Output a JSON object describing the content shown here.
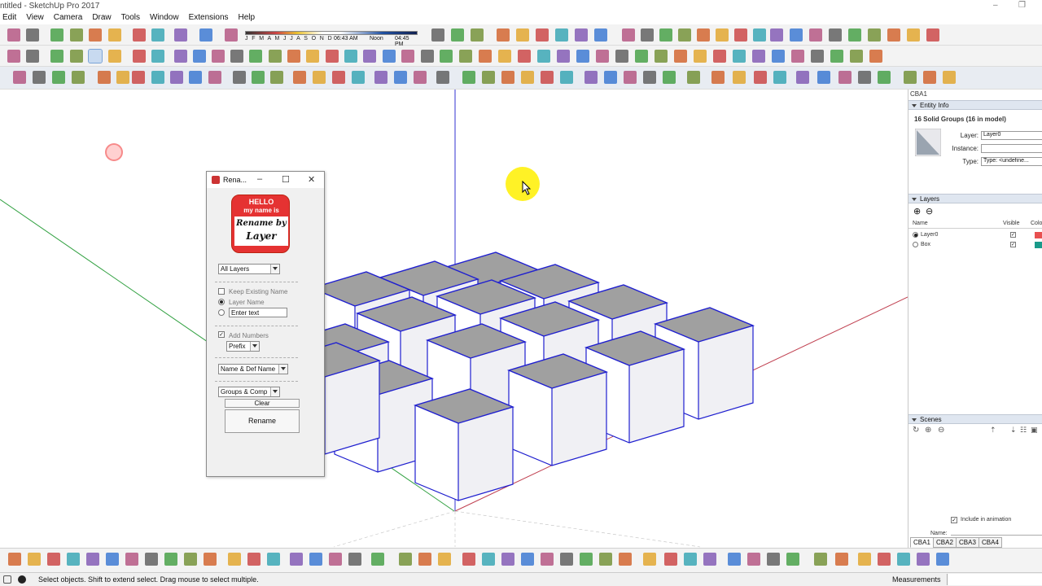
{
  "window": {
    "title": "ntitled - SketchUp Pro 2017",
    "controls": {
      "minimize": "–",
      "maximize": "❐"
    }
  },
  "menubar": {
    "items": [
      "Edit",
      "View",
      "Camera",
      "Draw",
      "Tools",
      "Window",
      "Extensions",
      "Help"
    ]
  },
  "time_slider": {
    "months": "J F M A M J J A S O N D",
    "sunrise": "06:43 AM",
    "noon": "Noon",
    "sunset": "04:45 PM"
  },
  "dialog": {
    "title": "Rena...",
    "controls": {
      "minimize": "–",
      "maximize": "☐",
      "close": "✕"
    },
    "logo": {
      "hello": "HELLO",
      "my_name_is": "my name is",
      "line1": "Rename by",
      "line2": "Layer"
    },
    "layer_filter": "All Layers",
    "keep_existing_name": {
      "label": "Keep Existing Name",
      "checked": false
    },
    "layer_name": {
      "label": "Layer Name",
      "selected": true
    },
    "enter_text": {
      "placeholder": "Enter text"
    },
    "add_numbers": {
      "label": "Add Numbers",
      "checked": true
    },
    "number_position": "Prefix",
    "name_mode": "Name & Def Name",
    "entity_type": "Groups & Comp",
    "clear_label": "Clear",
    "rename_label": "Rename"
  },
  "right_panel": {
    "tray_name": "CBA1",
    "entity_info": {
      "header": "Entity Info",
      "selection": "16 Solid Groups (16 in model)",
      "layer_label": "Layer:",
      "layer_value": "Layer0",
      "instance_label": "Instance:",
      "instance_value": "",
      "type_label": "Type:",
      "type_value": "Type: <undefine..."
    },
    "layers": {
      "header": "Layers",
      "add_icon": "⊕",
      "remove_icon": "⊖",
      "columns": {
        "name": "Name",
        "visible": "Visible",
        "color": "Colo"
      },
      "rows": [
        {
          "name": "Layer0",
          "current": true,
          "visible": true,
          "color": "#e85050"
        },
        {
          "name": "Box",
          "current": false,
          "visible": true,
          "color": "#1a9a8a"
        }
      ]
    },
    "scenes": {
      "header": "Scenes",
      "include_in_animation": "Include in animation",
      "name_label": "Name:"
    },
    "tabs": [
      "CBA1",
      "CBA2",
      "CBA3",
      "CBA4"
    ]
  },
  "statusbar": {
    "hint": "Select objects. Shift to extend select. Drag mouse to select multiple.",
    "measurements_label": "Measurements",
    "measurements_value": ""
  },
  "colors": {
    "red_axis": "#c04050",
    "green_axis": "#30a040",
    "blue_axis": "#3030d0",
    "cube_top": "#a0a0a0",
    "cube_side_light": "#ffffff",
    "cube_side_dark": "#f0f0f4",
    "cube_edge": "#1f1fd0",
    "highlight": "#ffef00"
  }
}
